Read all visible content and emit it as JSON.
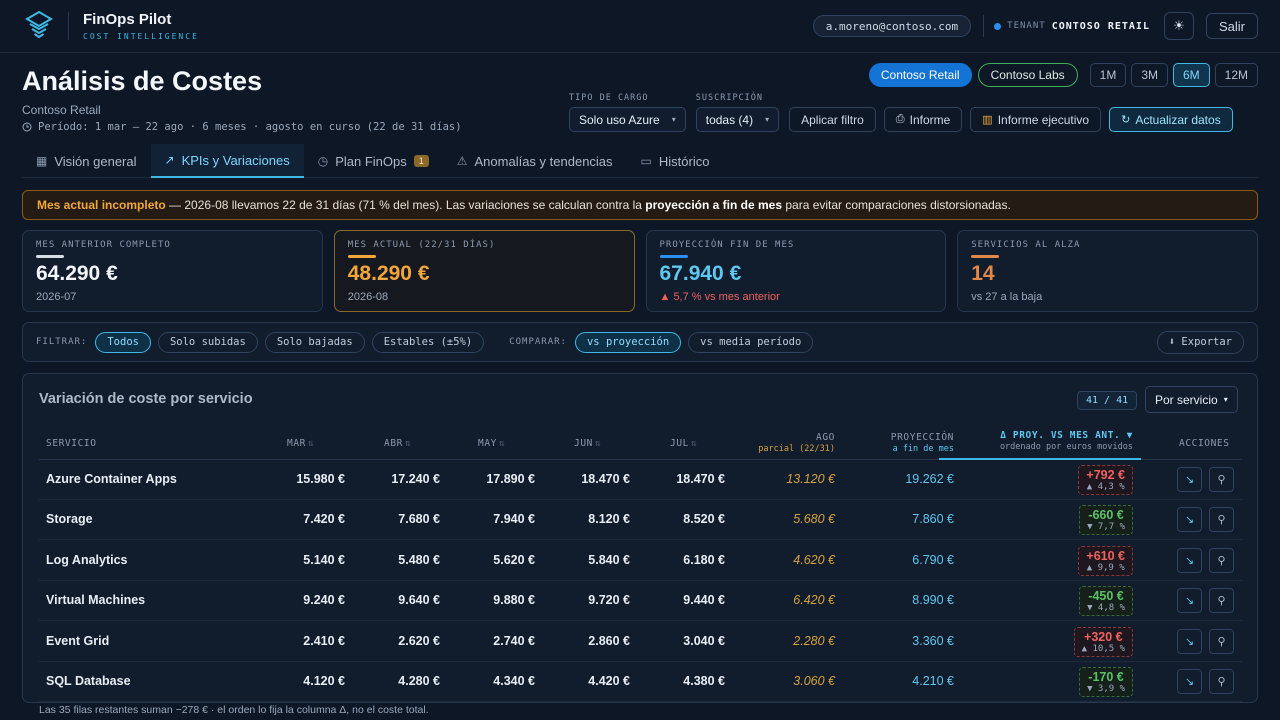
{
  "app": {
    "brand_name": "FinOps Pilot",
    "brand_sub": "COST INTELLIGENCE",
    "user_email": "a.moreno@contoso.com",
    "tenant_label": "TENANT",
    "tenant_name": "CONTOSO RETAIL",
    "logout_label": "Salir",
    "accent": "#3fb8e6"
  },
  "header": {
    "title": "Análisis de Costes",
    "subtitle": "Contoso Retail",
    "period": "Período: 1 mar – 22 ago · 6 meses · agosto en curso (22 de 31 días)",
    "tenants": [
      "Contoso Retail",
      "Contoso Labs"
    ],
    "ranges": [
      "1M",
      "3M",
      "6M",
      "12M"
    ],
    "active_range": "6M",
    "charge_type_label": "TIPO DE CARGO",
    "charge_type_value": "Solo uso Azure",
    "subscription_label": "SUSCRIPCIÓN",
    "subscription_value": "todas (4)",
    "apply_filter": "Aplicar filtro",
    "report": "Informe",
    "exec_report": "Informe ejecutivo",
    "refresh": "Actualizar datos"
  },
  "tabs": [
    {
      "label": "Visión general",
      "icon": "grid-icon"
    },
    {
      "label": "KPIs y Variaciones",
      "icon": "trend-icon",
      "active": true
    },
    {
      "label": "Plan FinOps",
      "icon": "clock-icon",
      "badge": "1"
    },
    {
      "label": "Anomalías y tendencias",
      "icon": "warning-icon"
    },
    {
      "label": "Histórico",
      "icon": "calendar-icon"
    }
  ],
  "alert": {
    "lead": "Mes actual incompleto",
    "text1": " — 2026-08 llevamos 22 de 31 días (71 % del mes). Las variaciones se calculan contra la ",
    "bold": "proyección a fin de mes",
    "text2": " para evitar comparaciones distorsionadas."
  },
  "kpis": [
    {
      "label": "MES ANTERIOR COMPLETO",
      "value": "64.290 €",
      "foot": "2026-07",
      "color": "#f2f6fb",
      "bar": "#d8dee7"
    },
    {
      "label": "MES ACTUAL (22/31 DÍAS)",
      "value": "48.290 €",
      "foot": "2026-08",
      "color": "#f2a73a",
      "bar": "#f2a73a"
    },
    {
      "label": "PROYECCIÓN FIN DE MES",
      "value": "67.940 €",
      "foot": "▲ 5,7 % vs mes anterior",
      "color": "#5ec8f0",
      "bar": "#2b8ff0",
      "foot_color": "#f0625e"
    },
    {
      "label": "SERVICIOS AL ALZA",
      "value": "14",
      "foot": "vs 27 a la baja",
      "color": "#e0874a",
      "bar": "#e0874a"
    }
  ],
  "filterbar": {
    "filter_label": "FILTRAR:",
    "filters": [
      "Todos",
      "Solo subidas",
      "Solo bajadas",
      "Estables (±5%)"
    ],
    "compare_label": "COMPARAR:",
    "compare": [
      "vs proyección",
      "vs media período"
    ],
    "export": "⬇ Exportar"
  },
  "table": {
    "title": "Variación de coste por servicio",
    "count": "41 / 41",
    "group_by": "Por servicio",
    "headers": {
      "service": "SERVICIO",
      "months": [
        "MAR",
        "ABR",
        "MAY",
        "JUN",
        "JUL"
      ],
      "ago": "AGO",
      "ago_sub": "parcial (22/31)",
      "proj": "PROYECCIÓN",
      "proj_sub": "a fin de mes",
      "delta": "Δ PROY. VS MES ANT. ▼",
      "delta_sub": "ordenado por euros movidos",
      "actions": "ACCIONES"
    },
    "rows": [
      {
        "service": "Azure Container Apps",
        "months": [
          "15.980 €",
          "17.240 €",
          "17.890 €",
          "18.470 €",
          "18.470 €"
        ],
        "ago": "13.120 €",
        "proj": "19.262 €",
        "delta": "+792 €",
        "pct": "▲ 4,3 %",
        "dir": "up"
      },
      {
        "service": "Storage",
        "months": [
          "7.420 €",
          "7.680 €",
          "7.940 €",
          "8.120 €",
          "8.520 €"
        ],
        "ago": "5.680 €",
        "proj": "7.860 €",
        "delta": "-660 €",
        "pct": "▼ 7,7 %",
        "dir": "down"
      },
      {
        "service": "Log Analytics",
        "months": [
          "5.140 €",
          "5.480 €",
          "5.620 €",
          "5.840 €",
          "6.180 €"
        ],
        "ago": "4.620 €",
        "proj": "6.790 €",
        "delta": "+610 €",
        "pct": "▲ 9,9 %",
        "dir": "up"
      },
      {
        "service": "Virtual Machines",
        "months": [
          "9.240 €",
          "9.640 €",
          "9.880 €",
          "9.720 €",
          "9.440 €"
        ],
        "ago": "6.420 €",
        "proj": "8.990 €",
        "delta": "-450 €",
        "pct": "▼ 4,8 %",
        "dir": "down"
      },
      {
        "service": "Event Grid",
        "months": [
          "2.410 €",
          "2.620 €",
          "2.740 €",
          "2.860 €",
          "3.040 €"
        ],
        "ago": "2.280 €",
        "proj": "3.360 €",
        "delta": "+320 €",
        "pct": "▲ 10,5 %",
        "dir": "up"
      },
      {
        "service": "SQL Database",
        "months": [
          "4.120 €",
          "4.280 €",
          "4.340 €",
          "4.420 €",
          "4.380 €"
        ],
        "ago": "3.060 €",
        "proj": "4.210 €",
        "delta": "-170 €",
        "pct": "▼ 3,9 %",
        "dir": "down"
      }
    ],
    "footnote": "Las 35 filas restantes suman −278 € · el orden lo fija la columna Δ, no el coste total."
  }
}
